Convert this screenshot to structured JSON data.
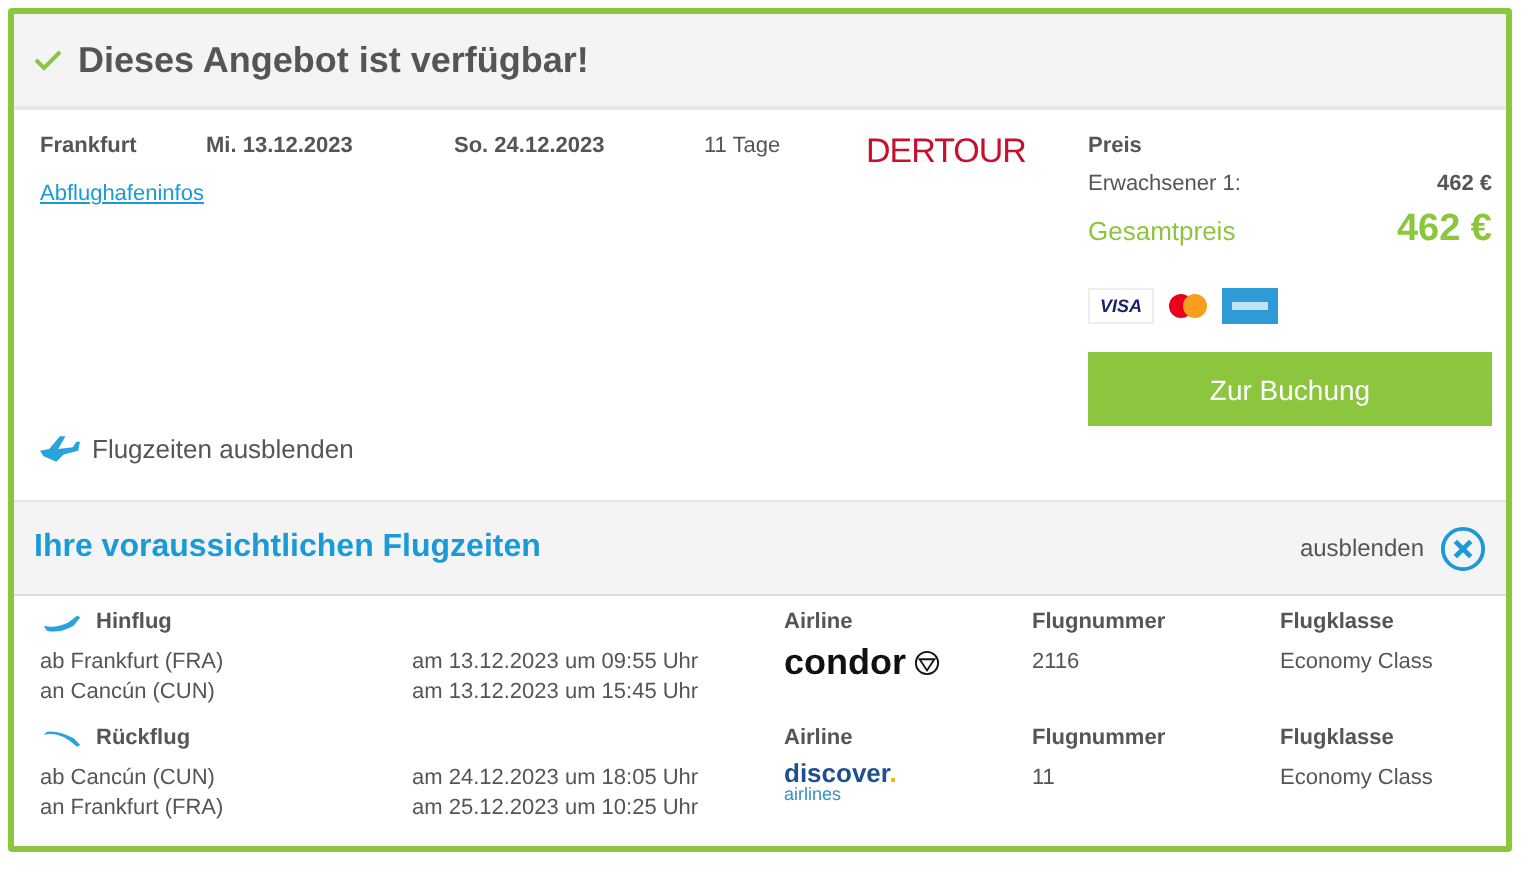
{
  "header": {
    "title": "Dieses Angebot ist verfügbar!"
  },
  "offer": {
    "departure_city": "Frankfurt",
    "outbound_date": "Mi. 13.12.2023",
    "return_date": "So. 24.12.2023",
    "duration": "11 Tage",
    "operator_logo": "DERTOUR",
    "airport_info_link": "Abflughafeninfos",
    "toggle_flight_times": "Flugzeiten ausblenden"
  },
  "price": {
    "heading": "Preis",
    "rows": [
      {
        "label": "Erwachsener 1:",
        "value": "462 €"
      }
    ],
    "total_label": "Gesamtpreis",
    "total_value": "462 €",
    "cards": [
      {
        "kind": "visa",
        "label": "VISA"
      },
      {
        "kind": "mastercard"
      },
      {
        "kind": "amex"
      }
    ],
    "book_button": "Zur Buchung"
  },
  "flight_times": {
    "title": "Ihre voraussichtlichen Flugzeiten",
    "hide_label": "ausblenden",
    "legs": [
      {
        "kind": "outbound",
        "title": "Hinflug",
        "segments": [
          {
            "place": "ab Frankfurt (FRA)",
            "time": "am 13.12.2023 um 09:55 Uhr"
          },
          {
            "place": "an Cancún (CUN)",
            "time": "am 13.12.2023 um 15:45 Uhr"
          }
        ],
        "airline_heading": "Airline",
        "airline": {
          "kind": "condor",
          "name": "condor"
        },
        "number_heading": "Flugnummer",
        "number": "2116",
        "class_heading": "Flugklasse",
        "class": "Economy Class"
      },
      {
        "kind": "return",
        "title": "Rückflug",
        "segments": [
          {
            "place": "ab Cancún (CUN)",
            "time": "am 24.12.2023 um 18:05 Uhr"
          },
          {
            "place": "an Frankfurt (FRA)",
            "time": "am 25.12.2023 um 10:25 Uhr"
          }
        ],
        "airline_heading": "Airline",
        "airline": {
          "kind": "discover",
          "name": "discover",
          "dot": ".",
          "tagline": "airlines"
        },
        "number_heading": "Flugnummer",
        "number": "11",
        "class_heading": "Flugklasse",
        "class": "Economy Class"
      }
    ]
  }
}
